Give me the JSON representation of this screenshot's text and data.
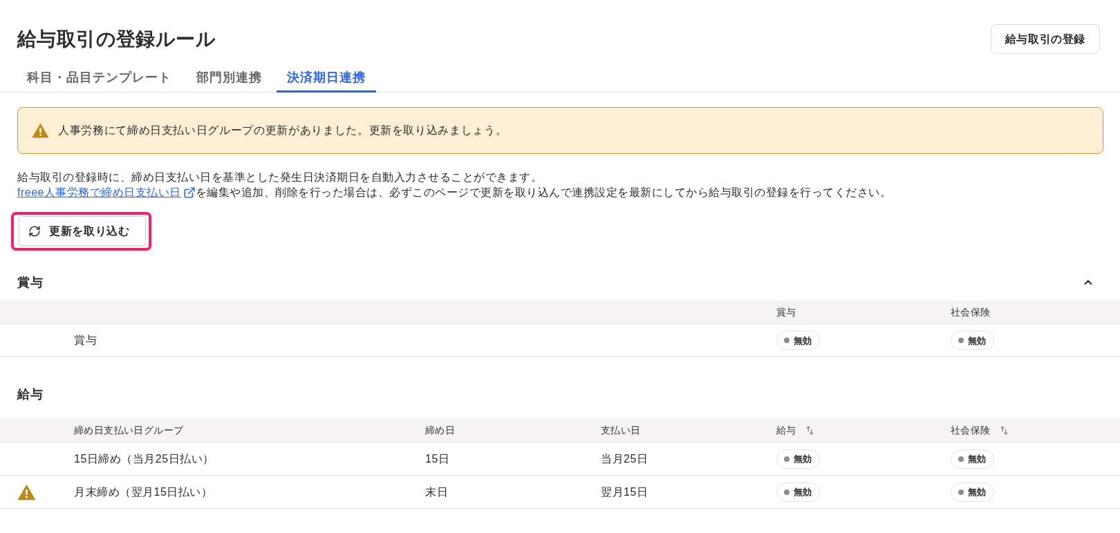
{
  "page": {
    "title": "給与取引の登録ルール",
    "register_button": "給与取引の登録"
  },
  "tabs": [
    {
      "label": "科目・品目テンプレート",
      "selected": false
    },
    {
      "label": "部門別連携",
      "selected": false
    },
    {
      "label": "決済期日連携",
      "selected": true
    }
  ],
  "alert": {
    "message": "人事労務にて締め日支払い日グループの更新がありました。更新を取り込みましょう。"
  },
  "description": {
    "line_1": "給与取引の登録時に、締め日支払い日を基準とした発生日決済期日を自動入力させることができます。",
    "link": "freee人事労務で締め日支払い日",
    "line_2": "を編集や追加、削除を行った場合は、必ずこのページで更新を取り込んで連携設定を最新にしてから給与取引の登録を行ってください。"
  },
  "import_button": {
    "label": "更新を取り込む",
    "highlighted": true
  },
  "bonus": {
    "title": "賞与",
    "expanded": true,
    "columns": [
      "賞与",
      "社会保険"
    ],
    "rows": [
      {
        "name": "賞与",
        "bonus": {
          "label": "無効",
          "active": false
        },
        "social_insurance": {
          "label": "無効",
          "active": false
        }
      }
    ]
  },
  "salary": {
    "title": "給与",
    "columns": [
      {
        "label": "締め日支払い日グループ",
        "sortable": false
      },
      {
        "label": "締め日",
        "sortable": false
      },
      {
        "label": "支払い日",
        "sortable": false
      },
      {
        "label": "給与",
        "sortable": true
      },
      {
        "label": "社会保険",
        "sortable": true
      }
    ],
    "rows": [
      {
        "warning": false,
        "group": "15日締め（当月25日払い）",
        "closing_day": "15日",
        "payment_day": "当月25日",
        "salary": {
          "label": "無効",
          "active": false
        },
        "social_insurance": {
          "label": "無効",
          "active": false
        }
      },
      {
        "warning": true,
        "group": "月末締め（翌月15日払い）",
        "closing_day": "末日",
        "payment_day": "翌月15日",
        "salary": {
          "label": "無効",
          "active": false
        },
        "social_insurance": {
          "label": "無効",
          "active": false
        }
      }
    ]
  }
}
